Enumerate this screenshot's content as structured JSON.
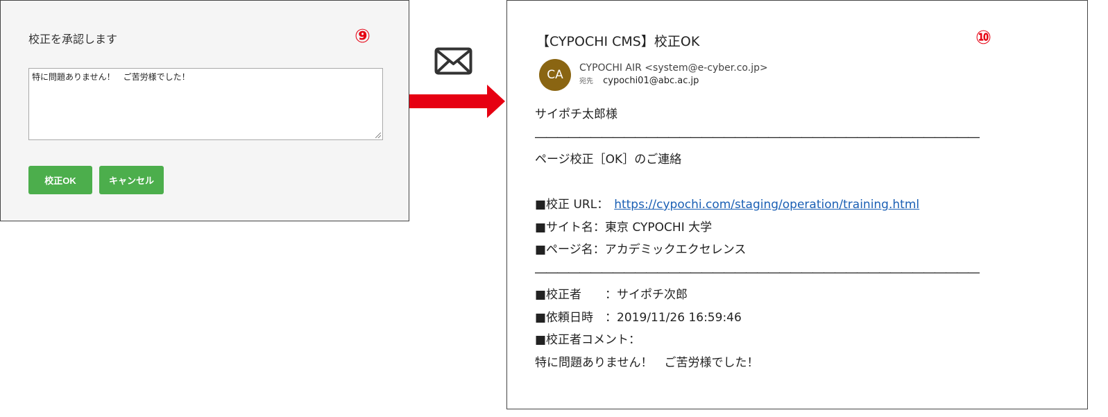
{
  "approve_panel": {
    "title": "校正を承認します",
    "step_label": "⑨",
    "comment_value": "特に問題ありません！　ご苦労様でした！",
    "ok_button": "校正OK",
    "cancel_button": "キャンセル"
  },
  "email": {
    "step_label": "⑩",
    "subject": "【CYPOCHI CMS】校正OK",
    "avatar_initials": "CA",
    "sender": "CYPOCHI AIR <system@e-cyber.co.jp>",
    "recipient_label": "宛先",
    "recipient": "cypochi01@abc.ac.jp",
    "greeting": "サイポチ太郎様",
    "rule": "――――――――――――――――――――――――――――――――――――――――",
    "notice": "ページ校正［OK］のご連絡",
    "url_label": "■校正 URL：",
    "url": "https://cypochi.com/staging/operation/training.html",
    "site_name": "■サイト名：東京 CYPOCHI 大学",
    "page_name": "■ページ名：アカデミックエクセレンス",
    "proofreader": "■校正者　　：サイポチ次郎",
    "request_datetime": "■依頼日時　：2019/11/26 16:59:46",
    "comment_label": "■校正者コメント：",
    "comment": "特に問題ありません！　ご苦労様でした！"
  },
  "colors": {
    "accent_red": "#e60012",
    "button_green": "#4cae4c",
    "avatar_brown": "#8a6512",
    "link_blue": "#1a5fb4"
  },
  "icons": [
    "mail-envelope-icon",
    "right-arrow-icon"
  ]
}
